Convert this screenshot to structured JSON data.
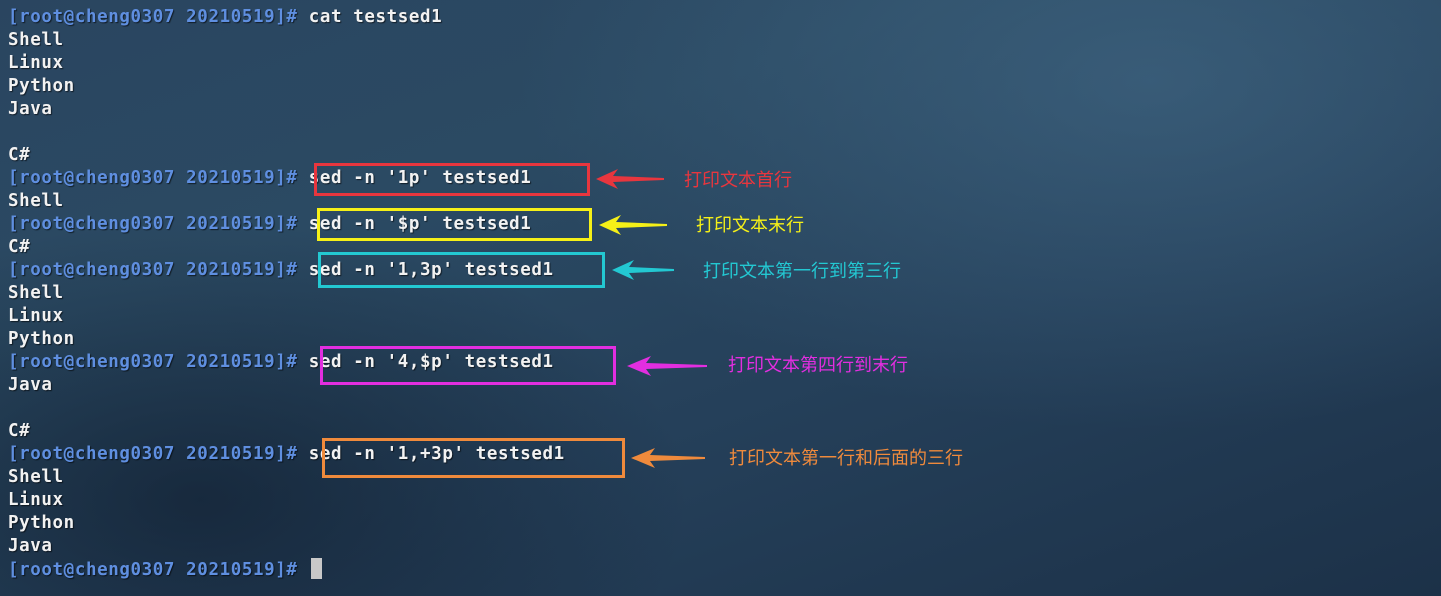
{
  "terminal": {
    "prompt": "[root@cheng0307 20210519]#",
    "lines": [
      {
        "type": "cmd",
        "command": "cat testsed1"
      },
      {
        "type": "out",
        "text": "Shell"
      },
      {
        "type": "out",
        "text": "Linux"
      },
      {
        "type": "out",
        "text": "Python"
      },
      {
        "type": "out",
        "text": "Java"
      },
      {
        "type": "out",
        "text": ""
      },
      {
        "type": "out",
        "text": "C#"
      },
      {
        "type": "cmd",
        "command": "sed -n '1p' testsed1"
      },
      {
        "type": "out",
        "text": "Shell"
      },
      {
        "type": "cmd",
        "command": "sed -n '$p' testsed1"
      },
      {
        "type": "out",
        "text": "C#"
      },
      {
        "type": "cmd",
        "command": "sed -n '1,3p' testsed1"
      },
      {
        "type": "out",
        "text": "Shell"
      },
      {
        "type": "out",
        "text": "Linux"
      },
      {
        "type": "out",
        "text": "Python"
      },
      {
        "type": "cmd",
        "command": "sed -n '4,$p' testsed1"
      },
      {
        "type": "out",
        "text": "Java"
      },
      {
        "type": "out",
        "text": ""
      },
      {
        "type": "out",
        "text": "C#"
      },
      {
        "type": "cmd",
        "command": "sed -n '1,+3p' testsed1"
      },
      {
        "type": "out",
        "text": "Shell"
      },
      {
        "type": "out",
        "text": "Linux"
      },
      {
        "type": "out",
        "text": "Python"
      },
      {
        "type": "out",
        "text": "Java"
      },
      {
        "type": "cursor"
      }
    ]
  },
  "annotations": [
    {
      "name": "first-line",
      "text": "打印文本首行",
      "color": "#e8363e"
    },
    {
      "name": "last-line",
      "text": "打印文本末行",
      "color": "#f5f018"
    },
    {
      "name": "lines-1-to-3",
      "text": "打印文本第一行到第三行",
      "color": "#23c8d2"
    },
    {
      "name": "line-4-to-end",
      "text": "打印文本第四行到末行",
      "color": "#e22ee0"
    },
    {
      "name": "line-1-plus-3",
      "text": "打印文本第一行和后面的三行",
      "color": "#ef8a3c"
    }
  ]
}
